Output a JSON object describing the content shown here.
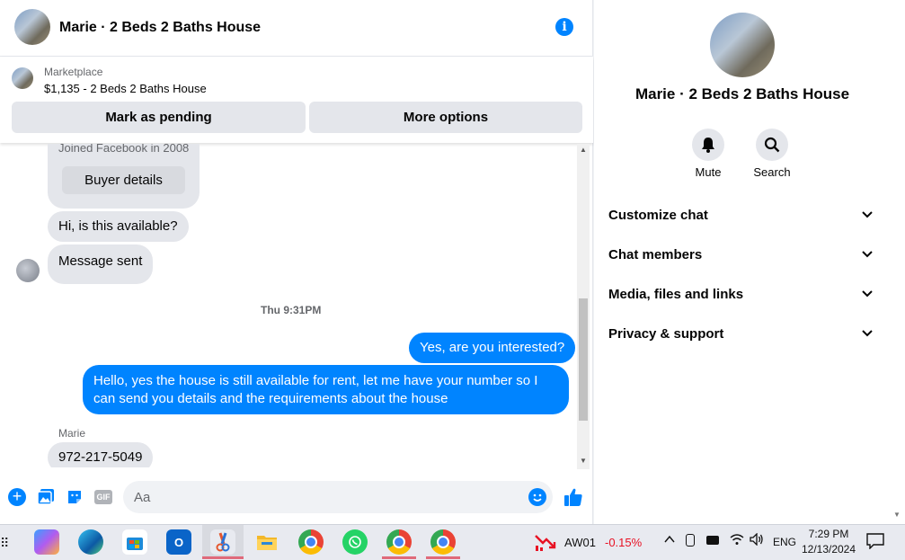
{
  "header": {
    "title": "Marie · 2 Beds 2 Baths House"
  },
  "listing": {
    "source_label": "Marketplace",
    "summary": "$1,135 - 2 Beds 2 Baths House",
    "mark_pending_label": "Mark as pending",
    "more_options_label": "More options"
  },
  "messages": {
    "joined_text": "Joined Facebook in 2008",
    "buyer_details_label": "Buyer details",
    "incoming_1": "Hi, is this available?",
    "incoming_2": "Message sent",
    "timestamp": "Thu 9:31PM",
    "outgoing_1": "Yes, are you interested?",
    "outgoing_2": "Hello, yes the house is still available for rent, let me have your number so I can send you details and the requirements about the house",
    "sender_name": "Marie",
    "incoming_3": "972-217-5049"
  },
  "composer": {
    "placeholder": "Aa",
    "gif_label": "GIF"
  },
  "sidebar": {
    "title": "Marie · 2 Beds 2 Baths House",
    "mute_label": "Mute",
    "search_label": "Search",
    "menu": [
      {
        "label": "Customize chat"
      },
      {
        "label": "Chat members"
      },
      {
        "label": "Media, files and links"
      },
      {
        "label": "Privacy & support"
      }
    ]
  },
  "taskbar": {
    "stock_ticker": "AW01",
    "stock_change": "-0.15%",
    "language": "ENG",
    "time": "7:29 PM",
    "date": "12/13/2024"
  },
  "colors": {
    "accent": "#0084ff",
    "negative": "#e81123"
  }
}
